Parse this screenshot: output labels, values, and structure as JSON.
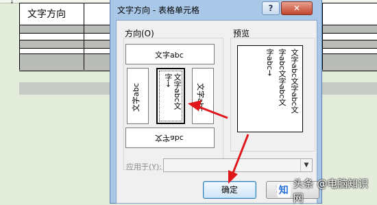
{
  "document": {
    "marker": "↓",
    "cell_text": "文字方向"
  },
  "dialog": {
    "title": "文字方向 - 表格单元格",
    "help_button": "?",
    "close_button": "✕",
    "direction_label": "方向(O)",
    "preview_label": "预览",
    "options": {
      "horizontal": "文字abc",
      "vertical_left": "文字abc",
      "stacked_col1": "文字abc文",
      "stacked_col2": "字→",
      "vertical_right": "文字abc",
      "bottom_inverted": "文字abc"
    },
    "preview_columns": [
      "文字abc文字abc文",
      "字abc文字abc文",
      "字abc→"
    ],
    "apply_to_label": "应用于(Y):",
    "apply_to_value": "",
    "ok_button": "确定",
    "cancel_button": "取"
  },
  "watermark": {
    "logo": "知",
    "text": "头条 @电脑知识网"
  },
  "colors": {
    "annotation_arrow": "#e0161a",
    "dialog_frame": "#a9c8e8",
    "ok_border": "#3c7fb1"
  }
}
